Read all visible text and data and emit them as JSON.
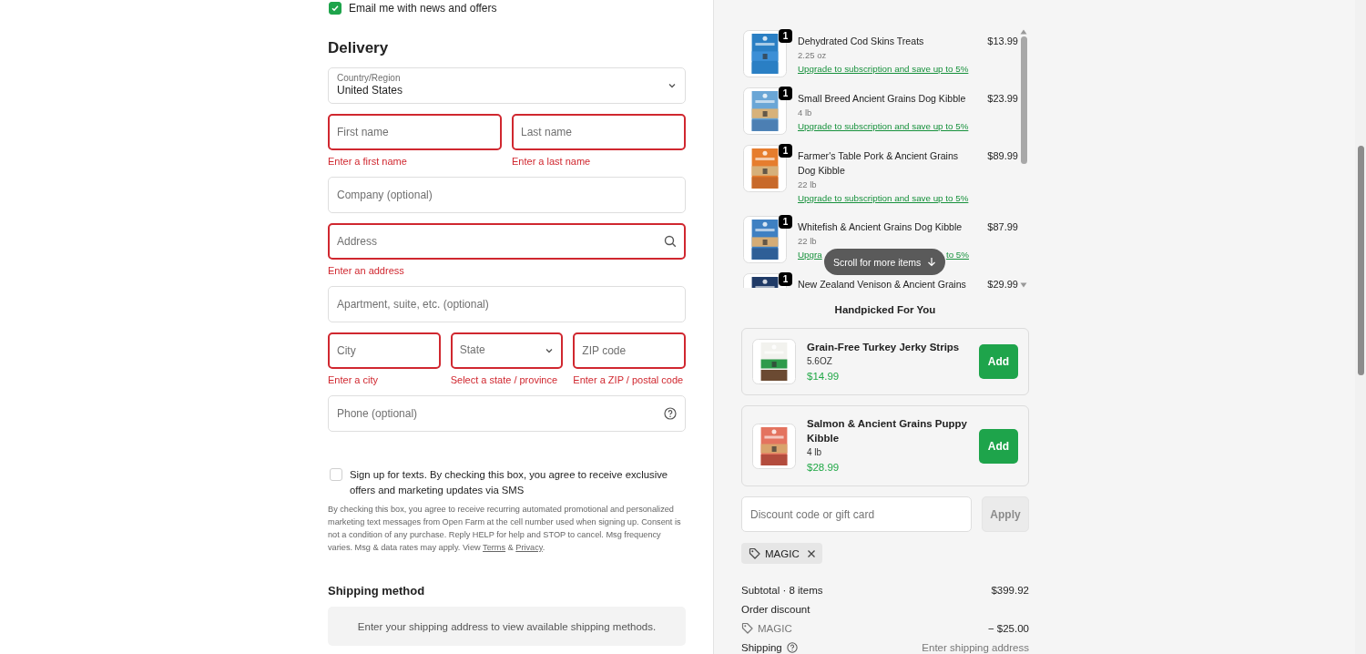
{
  "email_optin": {
    "label": "Email me with news and offers",
    "checked": true
  },
  "delivery": {
    "title": "Delivery",
    "rows": [
      [
        {
          "kind": "select",
          "label": "Country/Region",
          "value": "United States",
          "invalid": false
        }
      ],
      [
        {
          "kind": "text",
          "placeholder": "First name",
          "invalid": true,
          "error": "Enter a first name"
        },
        {
          "kind": "text",
          "placeholder": "Last name",
          "invalid": true,
          "error": "Enter a last name"
        }
      ],
      [
        {
          "kind": "text",
          "placeholder": "Company (optional)",
          "invalid": false
        }
      ],
      [
        {
          "kind": "search",
          "placeholder": "Address",
          "invalid": true,
          "error": "Enter an address"
        }
      ],
      [
        {
          "kind": "text",
          "placeholder": "Apartment, suite, etc. (optional)",
          "invalid": false
        }
      ],
      [
        {
          "kind": "text",
          "placeholder": "City",
          "invalid": true,
          "error": "Enter a city"
        },
        {
          "kind": "select",
          "placeholder": "State",
          "invalid": true,
          "error": "Select a state / province"
        },
        {
          "kind": "text",
          "placeholder": "ZIP code",
          "invalid": true,
          "error": "Enter a ZIP / postal code"
        }
      ],
      [
        {
          "kind": "help",
          "placeholder": "Phone (optional)",
          "invalid": false
        }
      ]
    ]
  },
  "sms_optin": {
    "label": "Sign up for texts. By checking this box, you agree to receive exclusive offers and marketing updates via SMS",
    "checked": false
  },
  "sms_disclaimer": [
    {
      "kind": "text",
      "text": "By checking this box, you agree to receive recurring automated promotional and personalized marketing text messages from Open Farm at the cell number used when signing up. Consent is not a condition of any purchase. Reply HELP for help and STOP to cancel. Msg frequency varies. Msg & data rates may apply. View "
    },
    {
      "kind": "link",
      "text": "Terms"
    },
    {
      "kind": "text",
      "text": " & "
    },
    {
      "kind": "link",
      "text": "Privacy"
    },
    {
      "kind": "text",
      "text": "."
    }
  ],
  "shipping_method": {
    "title": "Shipping method",
    "message": "Enter your shipping address to view available shipping methods."
  },
  "cart": {
    "items": [
      {
        "quantity": "1",
        "title": "Dehydrated Cod Skins Treats",
        "variant": "2.25 oz",
        "price": "$13.99",
        "upsell": "Upgrade to subscription and save up to 5%"
      },
      {
        "quantity": "1",
        "title": "Small Breed Ancient Grains Dog Kibble",
        "variant": "4 lb",
        "price": "$23.99",
        "upsell": "Upgrade to subscription and save up to 5%"
      },
      {
        "quantity": "1",
        "title": "Farmer's Table Pork & Ancient Grains Dog Kibble",
        "variant": "22 lb",
        "price": "$89.99",
        "upsell": "Upgrade to subscription and save up to 5%"
      },
      {
        "quantity": "1",
        "title": "Whitefish & Ancient Grains Dog Kibble",
        "variant": "22 lb",
        "price": "$87.99",
        "upsell": [
          "Upgra",
          "to 5%"
        ]
      },
      {
        "quantity": "1",
        "title": "New Zealand Venison & Ancient Grains",
        "price": "$29.99"
      }
    ],
    "scroll_hint": "Scroll for more items"
  },
  "recommendations": {
    "title": "Handpicked For You",
    "items": [
      {
        "title": "Grain-Free Turkey Jerky Strips",
        "variant": "5.6OZ",
        "price": "$14.99",
        "button": "Add"
      },
      {
        "title": "Salmon & Ancient Grains Puppy Kibble",
        "variant": "4 lb",
        "price": "$28.99",
        "button": "Add"
      }
    ]
  },
  "discount": {
    "placeholder": "Discount code or gift card",
    "button": {
      "label": "Apply",
      "disabled": true
    },
    "applied": [
      {
        "code": "MAGIC"
      }
    ]
  },
  "summary": {
    "rows": [
      {
        "kind": "line",
        "label": "Subtotal · 8 items",
        "value": "$399.92"
      },
      {
        "kind": "heading",
        "label": "Order discount"
      },
      {
        "kind": "code",
        "label": "MAGIC",
        "value": "− $25.00"
      },
      {
        "kind": "help",
        "label": "Shipping",
        "value": "Enter shipping address"
      }
    ]
  }
}
